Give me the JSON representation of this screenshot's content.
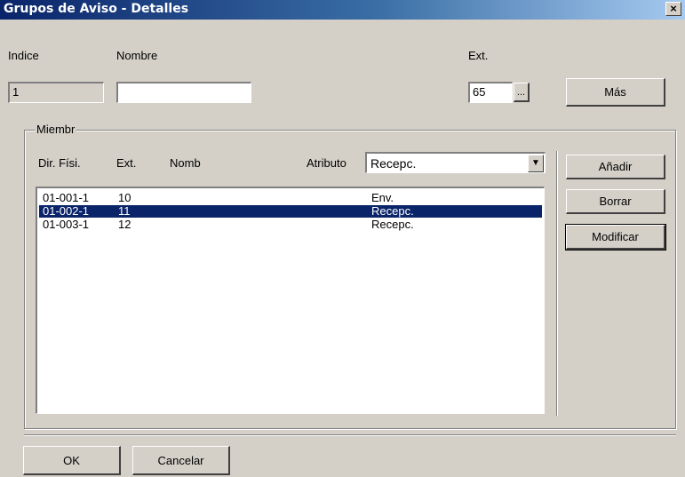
{
  "window": {
    "title": "Grupos de Aviso - Detalles",
    "close_glyph": "×"
  },
  "header": {
    "indice_label": "Indice",
    "nombre_label": "Nombre",
    "ext_label": "Ext.",
    "indice_value": "1",
    "nombre_value": "",
    "ext_value": "65",
    "browse_label": "...",
    "mas_label": "Más"
  },
  "group": {
    "legend": "Miembr",
    "columns": [
      "Dir. Físi.",
      "Ext.",
      "Nomb"
    ],
    "atributo_label": "Atributo",
    "atributo_value": "Recepc.",
    "rows": [
      {
        "dir": "01-001-1",
        "ext": "10",
        "nomb": "",
        "attr": "Env.",
        "selected": false
      },
      {
        "dir": "01-002-1",
        "ext": "11",
        "nomb": "",
        "attr": "Recepc.",
        "selected": true
      },
      {
        "dir": "01-003-1",
        "ext": "12",
        "nomb": "",
        "attr": "Recepc.",
        "selected": false
      }
    ],
    "buttons": {
      "add": "Añadir",
      "delete": "Borrar",
      "modify": "Modificar"
    }
  },
  "footer": {
    "ok": "OK",
    "cancel": "Cancelar"
  }
}
